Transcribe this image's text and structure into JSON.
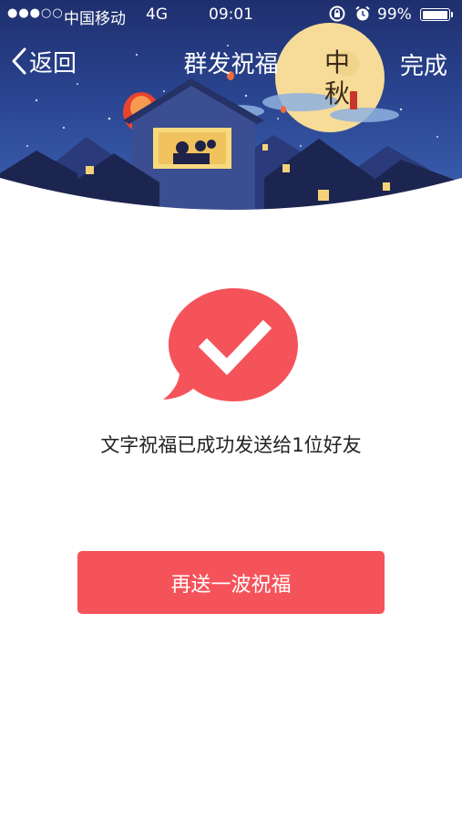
{
  "status_bar": {
    "signal": "●●●○○",
    "carrier": "中国移动",
    "network": "4G",
    "time": "09:01",
    "battery_percent": "99%",
    "battery_level": 0.99
  },
  "nav": {
    "back_label": "返回",
    "title": "群发祝福",
    "done_label": "完成"
  },
  "banner": {
    "moon_text_1": "中",
    "moon_text_2": "秋"
  },
  "result": {
    "message": "文字祝福已成功发送给1位好友"
  },
  "actions": {
    "resend_label": "再送一波祝福"
  },
  "colors": {
    "accent": "#f5535a",
    "banner_sky": "#2a4591",
    "moon": "#f6dc98"
  }
}
